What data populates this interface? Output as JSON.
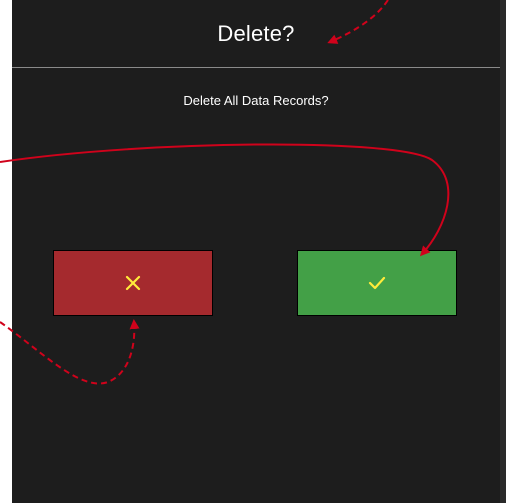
{
  "dialog": {
    "title": "Delete?",
    "message": "Delete All Data Records?",
    "cancel_button": {
      "icon": "close-icon",
      "color": "#a52a2e",
      "icon_color": "#ffeb3b"
    },
    "confirm_button": {
      "icon": "check-icon",
      "color": "#43a047",
      "icon_color": "#ffeb3b"
    }
  },
  "annotations": {
    "arrow_color": "#d0021b"
  }
}
